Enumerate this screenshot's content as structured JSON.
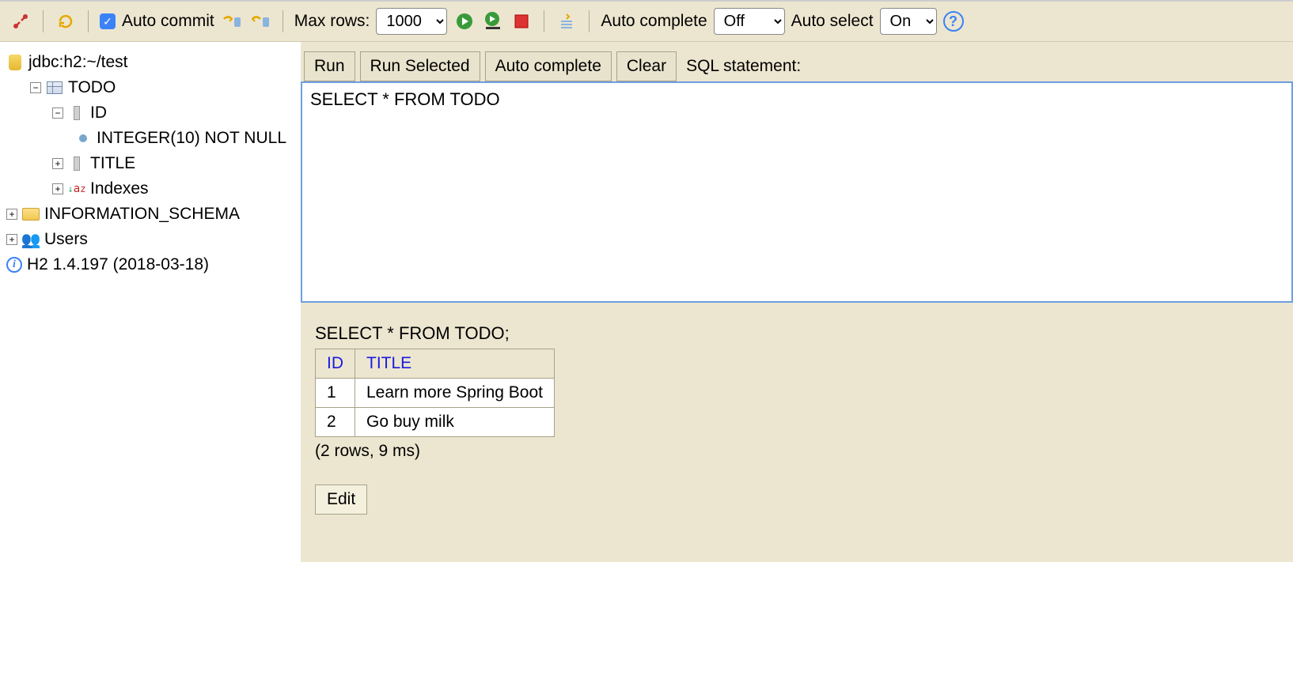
{
  "toolbar": {
    "auto_commit_label": "Auto commit",
    "max_rows_label": "Max rows:",
    "max_rows_value": "1000",
    "auto_complete_label": "Auto complete",
    "auto_complete_value": "Off",
    "auto_select_label": "Auto select",
    "auto_select_value": "On"
  },
  "tree": {
    "connection": "jdbc:h2:~/test",
    "table": "TODO",
    "col_id": "ID",
    "col_id_type": "INTEGER(10) NOT NULL",
    "col_title": "TITLE",
    "indexes": "Indexes",
    "schema": "INFORMATION_SCHEMA",
    "users": "Users",
    "version": "H2 1.4.197 (2018-03-18)"
  },
  "editor": {
    "run": "Run",
    "run_selected": "Run Selected",
    "auto_complete": "Auto complete",
    "clear": "Clear",
    "stmt_label": "SQL statement:",
    "sql": "SELECT * FROM TODO"
  },
  "result": {
    "executed_sql": "SELECT * FROM TODO;",
    "columns": [
      "ID",
      "TITLE"
    ],
    "rows": [
      {
        "id": "1",
        "title": "Learn more Spring Boot"
      },
      {
        "id": "2",
        "title": "Go buy milk"
      }
    ],
    "stats": "(2 rows, 9 ms)",
    "edit": "Edit"
  }
}
